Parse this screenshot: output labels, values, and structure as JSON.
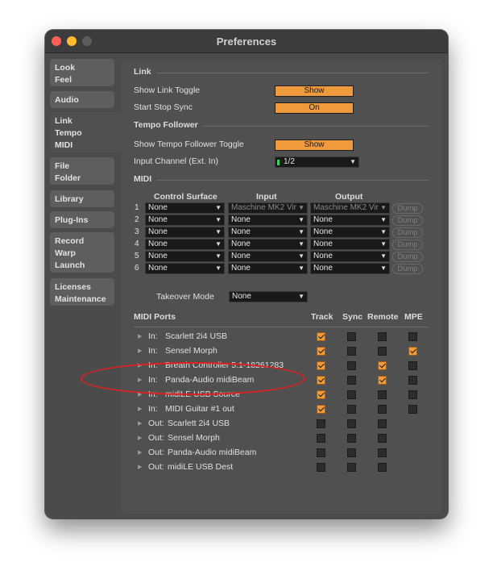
{
  "window": {
    "title": "Preferences"
  },
  "colors": {
    "accent": "#f09a3e",
    "annotation": "#e02020"
  },
  "sidebar": {
    "tabs": [
      {
        "id": "look-feel",
        "lines": [
          "Look",
          "Feel"
        ]
      },
      {
        "id": "audio",
        "lines": [
          "Audio"
        ]
      },
      {
        "id": "link-tempo-midi",
        "lines": [
          "Link",
          "Tempo",
          "MIDI"
        ],
        "active": true
      },
      {
        "id": "file-folder",
        "lines": [
          "File",
          "Folder"
        ]
      },
      {
        "id": "library",
        "lines": [
          "Library"
        ]
      },
      {
        "id": "plugins",
        "lines": [
          "Plug-Ins"
        ]
      },
      {
        "id": "record-warp-launch",
        "lines": [
          "Record",
          "Warp",
          "Launch"
        ]
      },
      {
        "id": "licenses-maintenance",
        "lines": [
          "Licenses",
          "Maintenance"
        ]
      }
    ]
  },
  "link": {
    "header": "Link",
    "show_link_toggle_label": "Show Link Toggle",
    "show_link_toggle_value": "Show",
    "start_stop_sync_label": "Start Stop Sync",
    "start_stop_sync_value": "On"
  },
  "tempo_follower": {
    "header": "Tempo Follower",
    "show_toggle_label": "Show Tempo Follower Toggle",
    "show_toggle_value": "Show",
    "input_channel_label": "Input Channel (Ext. In)",
    "input_channel_value": "1/2"
  },
  "midi": {
    "header": "MIDI",
    "col_control_surface": "Control Surface",
    "col_input": "Input",
    "col_output": "Output",
    "dump_label": "Dump",
    "rows": [
      {
        "n": "1",
        "surface": "None",
        "input": "Maschine MK2 Vir",
        "output": "Maschine MK2 Vir",
        "input_disabled": true,
        "output_disabled": true
      },
      {
        "n": "2",
        "surface": "None",
        "input": "None",
        "output": "None"
      },
      {
        "n": "3",
        "surface": "None",
        "input": "None",
        "output": "None"
      },
      {
        "n": "4",
        "surface": "None",
        "input": "None",
        "output": "None"
      },
      {
        "n": "5",
        "surface": "None",
        "input": "None",
        "output": "None"
      },
      {
        "n": "6",
        "surface": "None",
        "input": "None",
        "output": "None"
      }
    ],
    "takeover_label": "Takeover Mode",
    "takeover_value": "None"
  },
  "midi_ports": {
    "header": "MIDI Ports",
    "col_track": "Track",
    "col_sync": "Sync",
    "col_remote": "Remote",
    "col_mpe": "MPE",
    "ports": [
      {
        "dir": "In:",
        "name": "Scarlett 2i4 USB",
        "track": true,
        "sync": false,
        "remote": false,
        "mpe": false
      },
      {
        "dir": "In:",
        "name": "Sensel Morph",
        "track": true,
        "sync": false,
        "remote": false,
        "mpe": true
      },
      {
        "dir": "In:",
        "name": "Breath Controller 5.1-18261283",
        "track": true,
        "sync": false,
        "remote": true,
        "mpe": false
      },
      {
        "dir": "In:",
        "name": "Panda-Audio midiBeam",
        "track": true,
        "sync": false,
        "remote": true,
        "mpe": false
      },
      {
        "dir": "In:",
        "name": "midiLE USB Source",
        "track": true,
        "sync": false,
        "remote": false,
        "mpe": false
      },
      {
        "dir": "In:",
        "name": "MIDI Guitar #1 out",
        "track": true,
        "sync": false,
        "remote": false,
        "mpe": false
      },
      {
        "dir": "Out:",
        "name": "Scarlett 2i4 USB",
        "track": false,
        "sync": false,
        "remote": false
      },
      {
        "dir": "Out:",
        "name": "Sensel Morph",
        "track": false,
        "sync": false,
        "remote": false
      },
      {
        "dir": "Out:",
        "name": "Panda-Audio midiBeam",
        "track": false,
        "sync": false,
        "remote": false
      },
      {
        "dir": "Out:",
        "name": "midiLE USB Dest",
        "track": false,
        "sync": false,
        "remote": false
      }
    ]
  }
}
